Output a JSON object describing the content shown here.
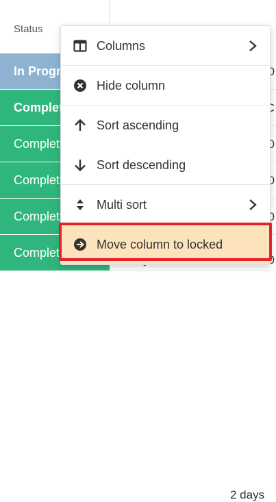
{
  "grid": {
    "header": {
      "status_label": "Status"
    },
    "rows": [
      {
        "status": "In Progr",
        "bold": true,
        "color": "#8fb2d3",
        "tail": "0",
        "duration": ""
      },
      {
        "status": "Complet",
        "bold": true,
        "color": "#2fb67c",
        "tail": "C",
        "duration": ""
      },
      {
        "status": "Complet",
        "bold": false,
        "color": "#2fb67c",
        "tail": "0",
        "duration": ""
      },
      {
        "status": "Complet",
        "bold": false,
        "color": "#2fb67c",
        "tail": "0",
        "duration": ""
      },
      {
        "status": "Complet",
        "bold": false,
        "color": "#2fb67c",
        "tail": "0",
        "duration": ""
      },
      {
        "status": "Completed",
        "bold": false,
        "color": "#2fb67c",
        "tail": "00/17/20",
        "duration": "2 days"
      }
    ]
  },
  "menu": {
    "items": [
      {
        "label": "Columns",
        "icon": "columns-icon",
        "has_submenu": true
      },
      {
        "label": "Hide column",
        "icon": "close-circle-icon",
        "has_submenu": false
      },
      {
        "label": "Sort ascending",
        "icon": "arrow-up-icon",
        "has_submenu": false
      },
      {
        "label": "Sort descending",
        "icon": "arrow-down-icon",
        "has_submenu": false
      },
      {
        "label": "Multi sort",
        "icon": "sort-icon",
        "has_submenu": true
      },
      {
        "label": "Move column to locked",
        "icon": "arrow-right-circle-icon",
        "has_submenu": false,
        "highlighted": true
      }
    ]
  },
  "colors": {
    "in_progress": "#8fb2d3",
    "completed": "#2fb67c",
    "highlight_bg": "#fde3bb",
    "focus_border": "#e3242b"
  }
}
